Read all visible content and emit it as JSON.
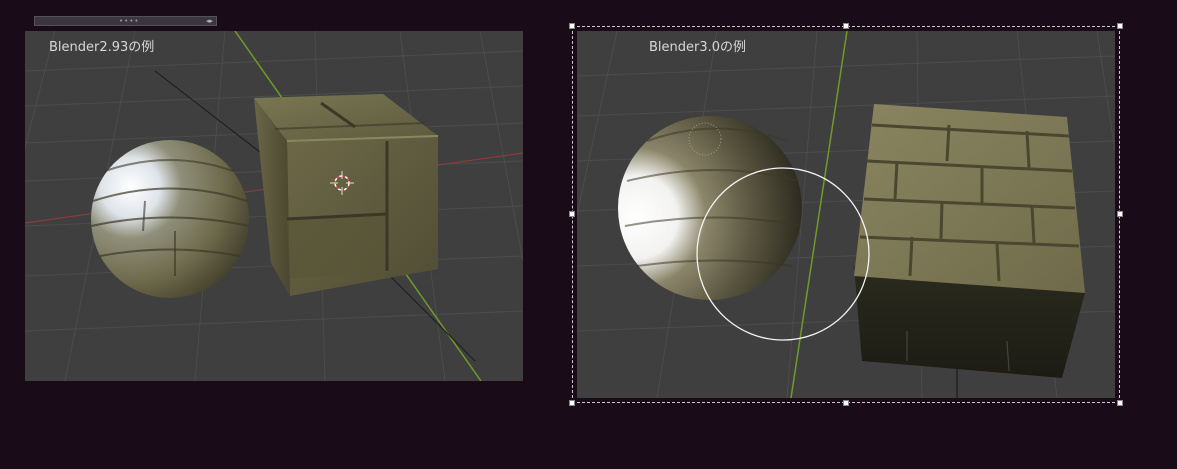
{
  "toolbar": {
    "grip": "••••",
    "arrows": "◂▸"
  },
  "left_viewport": {
    "label": "Blender2.93の例"
  },
  "right_viewport": {
    "label": "Blender3.0の例"
  },
  "icons": {
    "cursor": "3d-cursor-icon",
    "brush": "brush-circle-icon"
  },
  "colors": {
    "background": "#1a0b18",
    "viewport": "#3f3f3f",
    "y_axis": "#6f9a2a",
    "x_axis": "#8a3b3b"
  }
}
